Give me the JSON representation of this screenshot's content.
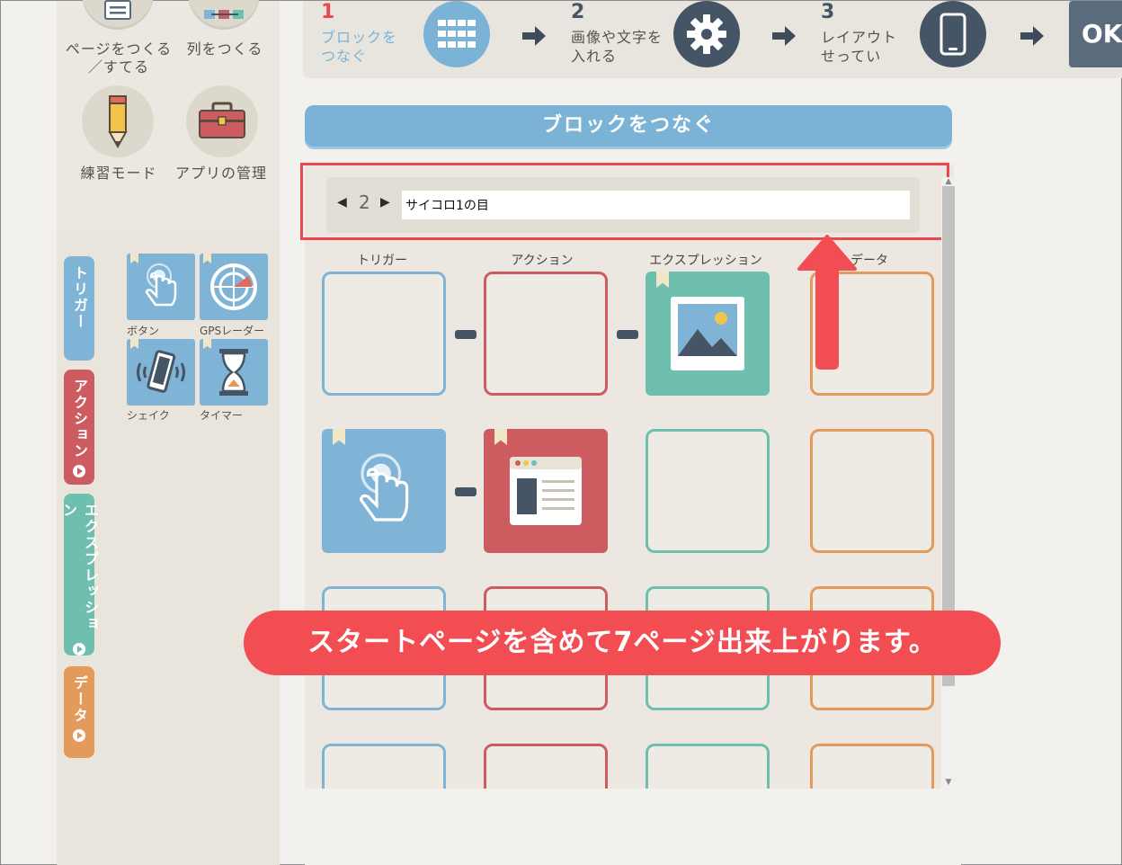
{
  "colors": {
    "trigger": "#7fb4d6",
    "action": "#cc5c60",
    "expression": "#6fbfae",
    "data": "#e39a5b",
    "highlight": "#e8494f",
    "navy": "#465565"
  },
  "menu": {
    "items": [
      {
        "label": "ページをつくる／すてる",
        "line1": "ページをつくる",
        "line2": "／すてる",
        "icon": "page-icon"
      },
      {
        "label": "列をつくる",
        "icon": "columns-icon"
      },
      {
        "label": "練習モード",
        "icon": "pencil-icon"
      },
      {
        "label": "アプリの管理",
        "icon": "toolbox-icon"
      }
    ]
  },
  "categories": [
    {
      "label": "トリガー",
      "color": "#7fb4d6"
    },
    {
      "label": "アクション",
      "color": "#cc5c60"
    },
    {
      "label": "エクスプレッション",
      "color": "#6fbfae"
    },
    {
      "label": "データ",
      "color": "#e39a5b"
    }
  ],
  "palette": [
    {
      "label": "ボタン",
      "icon": "tap-icon"
    },
    {
      "label": "GPSレーダー",
      "icon": "radar-icon"
    },
    {
      "label": "シェイク",
      "icon": "shake-icon"
    },
    {
      "label": "タイマー",
      "icon": "hourglass-icon"
    }
  ],
  "steps": [
    {
      "num": "1",
      "line1": "ブロックを",
      "line2": "つなぐ",
      "icon": "blocks-icon"
    },
    {
      "num": "2",
      "line1": "画像や文字を",
      "line2": "入れる",
      "icon": "gear-icon"
    },
    {
      "num": "3",
      "line1": "レイアウト",
      "line2": "せってい",
      "icon": "phone-icon"
    }
  ],
  "ok_label": "OK",
  "section_title": "ブロックをつなぐ",
  "page_nav": {
    "page": "2",
    "title_value": "サイコロ1の目",
    "prev_glyph": "◀",
    "next_glyph": "▶"
  },
  "columns": [
    "トリガー",
    "アクション",
    "エクスプレッション",
    "データ"
  ],
  "callout_text": "スタートページを含めて7ページ出来上がります。"
}
